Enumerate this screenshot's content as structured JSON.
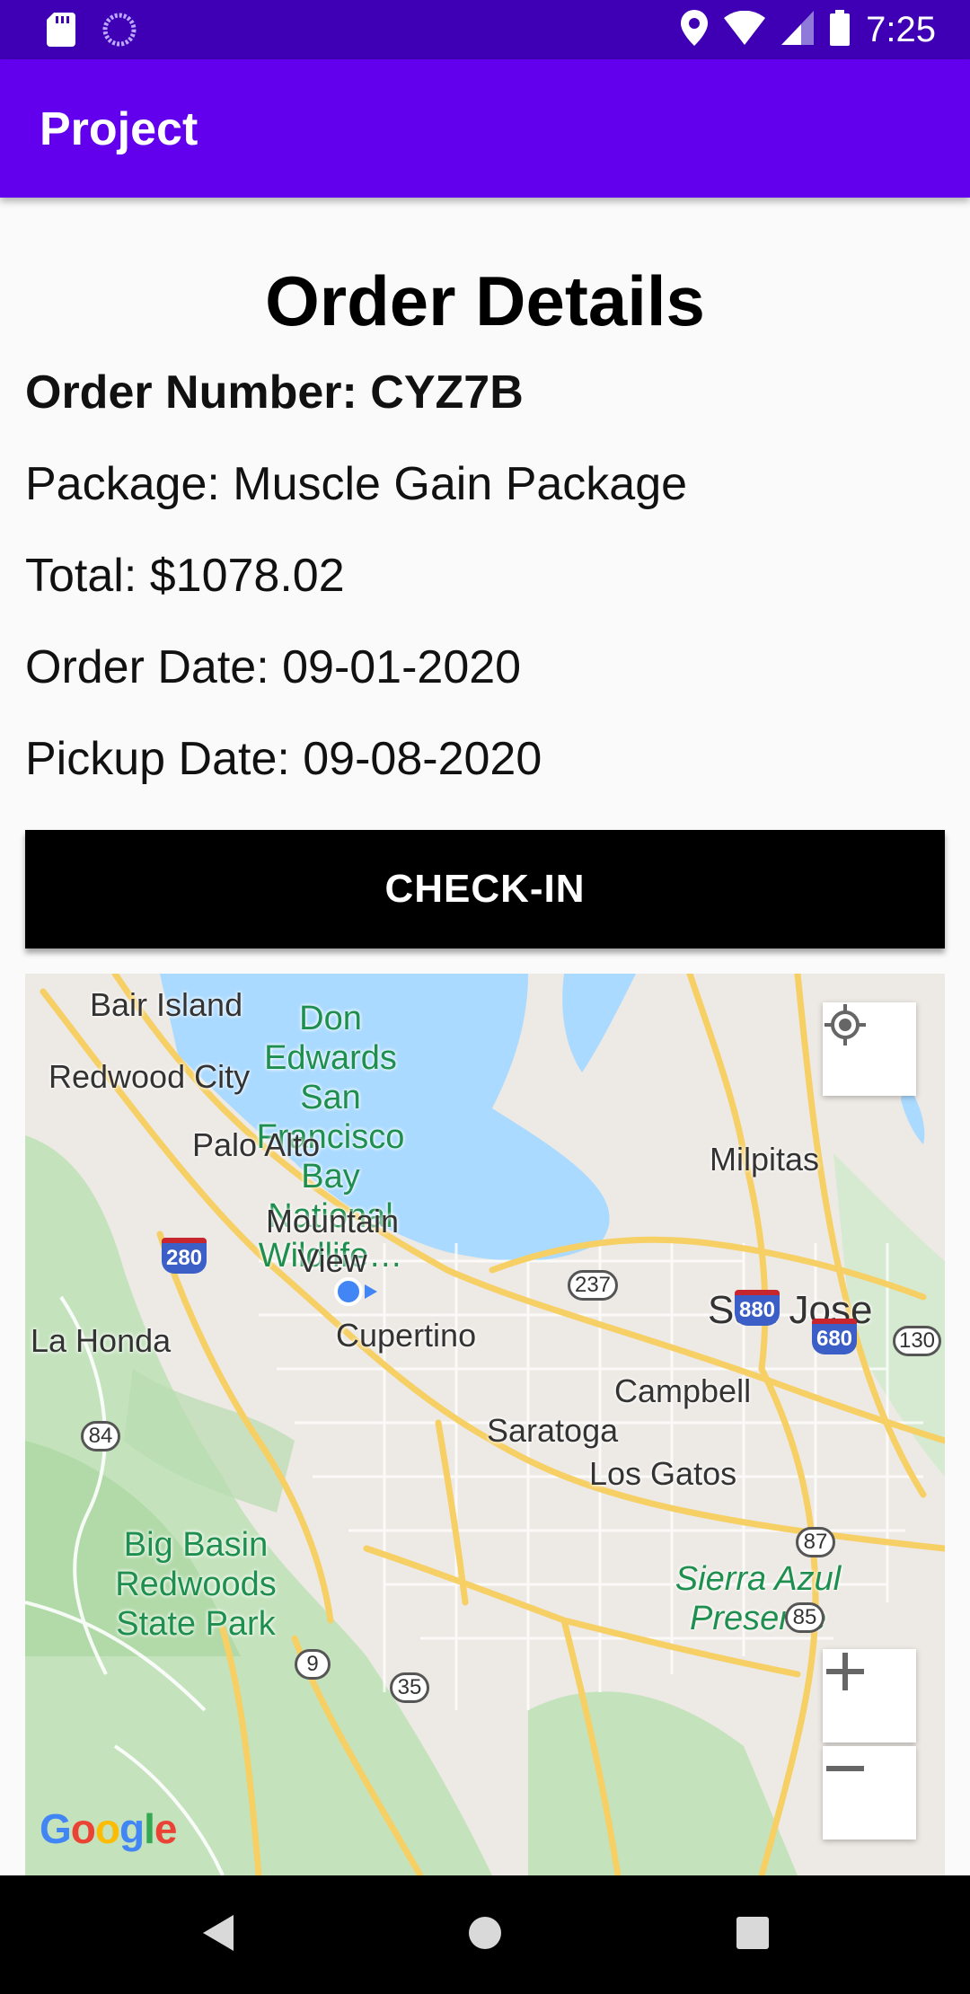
{
  "status_bar": {
    "time": "7:25",
    "icons": [
      "sd-card-icon",
      "sync-icon",
      "location-icon",
      "wifi-icon",
      "signal-icon",
      "battery-icon"
    ]
  },
  "app_bar": {
    "title": "Project"
  },
  "order": {
    "heading": "Order Details",
    "number_line": "Order Number: CYZ7B",
    "package_line": "Package: Muscle Gain Package",
    "total_line": "Total: $1078.02",
    "order_date_line": "Order Date: 09-01-2020",
    "pickup_date_line": "Pickup Date: 09-08-2020"
  },
  "checkin_button": {
    "label": "CHECK-IN"
  },
  "map": {
    "labels": {
      "bair_island": "Bair Island",
      "don_edwards": "Don Edwards San Francisco Bay National Wildlife…",
      "redwood_city": "Redwood City",
      "palo_alto": "Palo Alto",
      "milpitas": "Milpitas",
      "mountain_view": "Mountain View",
      "san_jose": "San Jose",
      "la_honda": "La Honda",
      "cupertino": "Cupertino",
      "campbell": "Campbell",
      "saratoga": "Saratoga",
      "los_gatos": "Los Gatos",
      "big_basin": "Big Basin Redwoods State Park",
      "sierra_azul": "Sierra Azul Preserve"
    },
    "shields": {
      "i280": "280",
      "s237": "237",
      "i880": "880",
      "i680": "680",
      "s130": "130",
      "s84": "84",
      "s87": "87",
      "s85": "85",
      "s9": "9",
      "s35": "35"
    },
    "logo": "Google",
    "controls": [
      "my-location",
      "zoom-in",
      "zoom-out"
    ],
    "colors": {
      "water": "#aadaff",
      "land": "#ede9e4",
      "park": "#c4e3bd",
      "highway": "#f6cf65",
      "location_dot": "#4285f4"
    }
  },
  "nav_bar": {
    "buttons": [
      "back",
      "home",
      "recents"
    ]
  }
}
